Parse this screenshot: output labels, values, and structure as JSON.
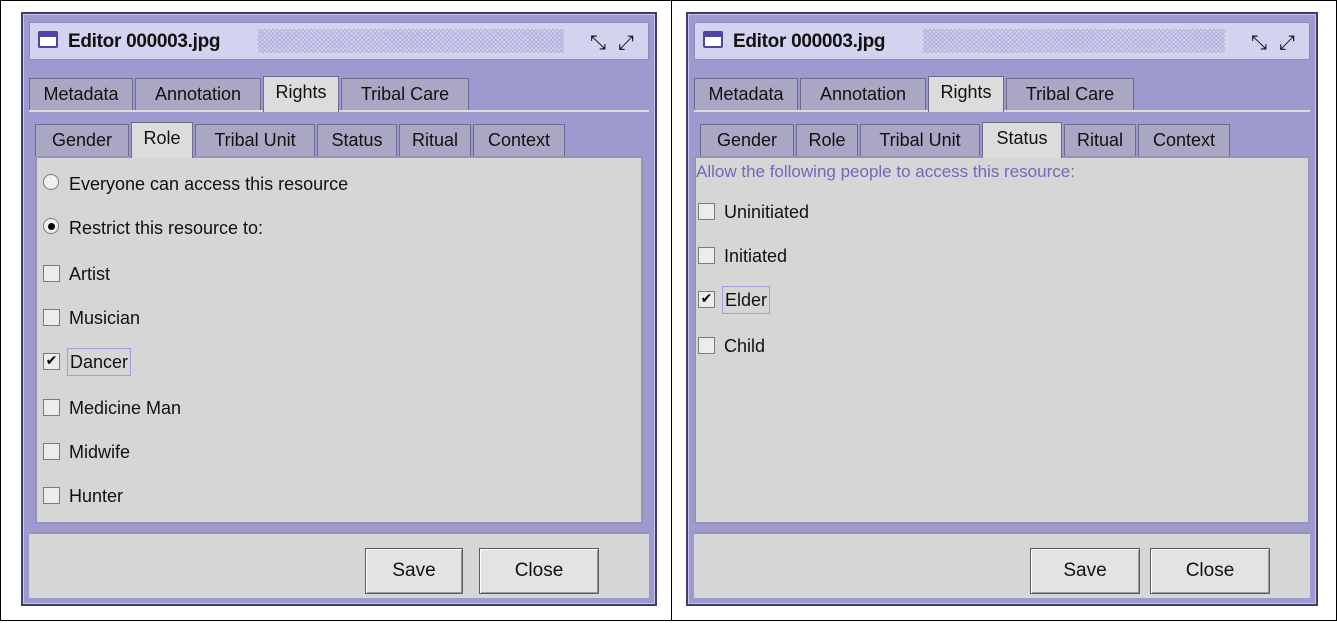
{
  "window1": {
    "title": "Editor 000003.jpg",
    "main_tabs": [
      "Metadata",
      "Annotation",
      "Rights",
      "Tribal Care"
    ],
    "selected_main_tab": "Rights",
    "sub_tabs": [
      "Gender",
      "Role",
      "Tribal Unit",
      "Status",
      "Ritual",
      "Context"
    ],
    "selected_sub_tab": "Role",
    "radios": [
      {
        "label": "Everyone can access this resource",
        "selected": false
      },
      {
        "label": "Restrict this resource to:",
        "selected": true
      }
    ],
    "checkboxes": [
      {
        "label": "Artist",
        "checked": false
      },
      {
        "label": "Musician",
        "checked": false
      },
      {
        "label": "Dancer",
        "checked": true
      },
      {
        "label": "Medicine Man",
        "checked": false
      },
      {
        "label": "Midwife",
        "checked": false
      },
      {
        "label": "Hunter",
        "checked": false
      }
    ],
    "buttons": {
      "save": "Save",
      "close": "Close"
    }
  },
  "window2": {
    "title": "Editor 000003.jpg",
    "main_tabs": [
      "Metadata",
      "Annotation",
      "Rights",
      "Tribal Care"
    ],
    "selected_main_tab": "Rights",
    "sub_tabs": [
      "Gender",
      "Role",
      "Tribal Unit",
      "Status",
      "Ritual",
      "Context"
    ],
    "selected_sub_tab": "Status",
    "hint": "Allow the following people to access this resource:",
    "checkboxes": [
      {
        "label": "Uninitiated",
        "checked": false
      },
      {
        "label": "Initiated",
        "checked": false
      },
      {
        "label": "Elder",
        "checked": true
      },
      {
        "label": "Child",
        "checked": false
      }
    ],
    "buttons": {
      "save": "Save",
      "close": "Close"
    }
  },
  "icons": {
    "app": "window-icon",
    "minimize": "minimize-icon",
    "maximize": "maximize-icon",
    "check": "✔"
  },
  "colors": {
    "frame": "#9d9ad0",
    "title_bg": "#d3d2ef",
    "panel": "#d6d6d6",
    "tab": "#a9a7c4",
    "hint": "#6e6ab8"
  }
}
